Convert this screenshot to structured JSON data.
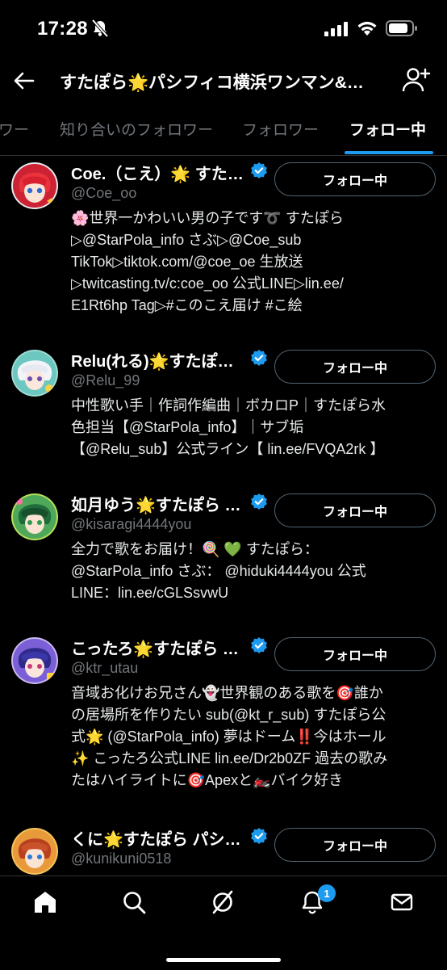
{
  "status_bar": {
    "time": "17:28"
  },
  "header": {
    "title": "すたぽら🌟パシフィコ横浜ワンマン&…"
  },
  "tabs": [
    {
      "label": "ワー"
    },
    {
      "label": "知り合いのフォロワー"
    },
    {
      "label": "フォロワー"
    },
    {
      "label": "フォロー中"
    }
  ],
  "accounts": [
    {
      "name": "Coe.（こえ）🌟 すたぽら パシフィコ横浜",
      "handle": "@Coe_oo",
      "button": "フォロー中",
      "bio": "🌸世界一かわいい男の子です➰ すたぽら\n▷@StarPola_info さぶ▷@Coe_sub\nTikTok▷tiktok.com/@coe_oe 生放送\n▷twitcasting.tv/c:coe_oo 公式LINE▷lin.ee/\nE1Rt6hp Tag▷#このこえ届け #こ絵"
    },
    {
      "name": "Relu(れる)🌟すたぽら パシフィコ",
      "handle": "@Relu_99",
      "button": "フォロー中",
      "bio": "中性歌い手｜作詞作編曲｜ボカロP｜すたぽら水\n色担当【@StarPola_info】｜サブ垢\n【@Relu_sub】公式ライン【 lin.ee/FVQA2rk 】"
    },
    {
      "name": "如月ゆう🌟すたぽら パシフィコ",
      "handle": "@kisaragi4444you",
      "button": "フォロー中",
      "bio": "全力で歌をお届け！🍭 💚 すたぽら：\n@StarPola_info さぶ： @hiduki4444you 公式\nLINE：lin.ee/cGLSsvwU"
    },
    {
      "name": "こったろ🌟すたぽら パシフィコ",
      "handle": "@ktr_utau",
      "button": "フォロー中",
      "bio": "音域お化けお兄さん👻世界観のある歌を🎯誰か\nの居場所を作りたい sub(@kt_r_sub) すたぽら公\n式🌟 (@StarPola_info) 夢はドーム‼️今はホール\n✨ こったろ公式LINE lin.ee/Dr2b0ZF 過去の歌み\nたはハイライトに🎯Apexと🏍️バイク好き"
    },
    {
      "name": "くに🌟すたぽら パシフィコ",
      "handle": "@kunikuni0518",
      "button": "フォロー中",
      "bio": ""
    }
  ],
  "bottom_nav": {
    "items": [
      "home-icon",
      "search-icon",
      "grok-icon",
      "bell-icon",
      "mail-icon"
    ],
    "notification_count": "1"
  },
  "colors": {
    "accent": "#1d9bf0",
    "background": "#000000",
    "muted": "#71767b",
    "border": "#2f3336"
  }
}
